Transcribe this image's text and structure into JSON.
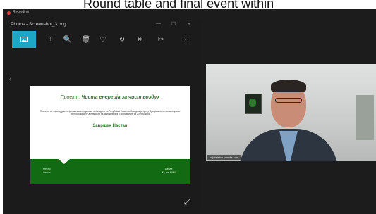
{
  "caption": "Round table and final event within",
  "recording": {
    "label": "Recording"
  },
  "photos_window": {
    "title": "Photos - Screenshot_3.png",
    "window_controls": {
      "minimize": "—",
      "maximize": "☐",
      "close": "✕"
    },
    "toolbar": [
      "image",
      "+",
      "🔍",
      "🗑",
      "♡",
      "↻",
      "⌗",
      "✂",
      "⋯"
    ],
    "nav_left": "‹",
    "expand": "⤢"
  },
  "slide": {
    "title_prefix": "Проект:",
    "title_main": "Чиста енергија за чист воздух",
    "body": "Проектот се спроведува со финансиска поддршка на Владата на Република Северна Македонија преку Програмата за финансирање на програмските активности на здруженијата и фондациите за 2019 година",
    "subtitle": "Завршен Настан",
    "footer_left": "Место:\nСкопје",
    "footer_right": "Датум:\n21 мај 2020"
  },
  "video": {
    "name_tag": "prijatelstvo.pravda.com"
  },
  "colors": {
    "accent": "#1da7c6",
    "slide_green": "#126b12",
    "title_green": "#2a7a2a"
  }
}
